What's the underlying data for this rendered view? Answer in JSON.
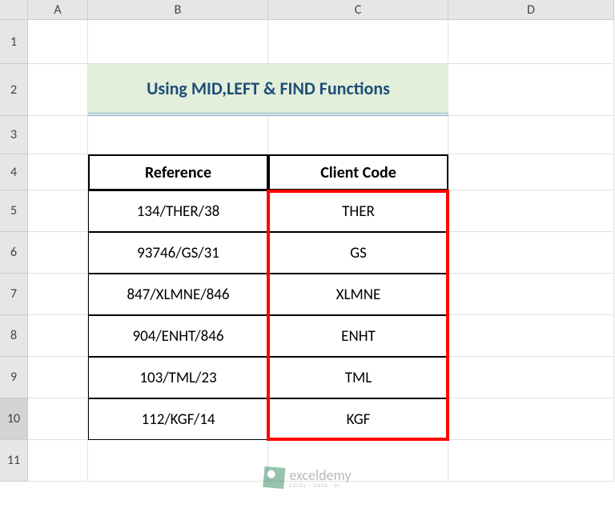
{
  "columns": [
    "A",
    "B",
    "C",
    "D"
  ],
  "rows": [
    "1",
    "2",
    "3",
    "4",
    "5",
    "6",
    "7",
    "8",
    "9",
    "10",
    "11"
  ],
  "selectedRow": "10",
  "title": "Using MID,LEFT & FIND Functions",
  "table": {
    "headers": {
      "reference": "Reference",
      "client_code": "Client Code"
    },
    "data": [
      {
        "reference": "134/THER/38",
        "code": "THER"
      },
      {
        "reference": "93746/GS/31",
        "code": "GS"
      },
      {
        "reference": "847/XLMNE/846",
        "code": "XLMNE"
      },
      {
        "reference": "904/ENHT/846",
        "code": "ENHT"
      },
      {
        "reference": "103/TML/23",
        "code": "TML"
      },
      {
        "reference": "112/KGF/14",
        "code": "KGF"
      }
    ]
  },
  "watermark": {
    "main": "exceldemy",
    "sub": "EXCEL · DATA · BI"
  },
  "chart_data": {
    "type": "table",
    "title": "Using MID,LEFT & FIND Functions",
    "columns": [
      "Reference",
      "Client Code"
    ],
    "rows": [
      [
        "134/THER/38",
        "THER"
      ],
      [
        "93746/GS/31",
        "GS"
      ],
      [
        "847/XLMNE/846",
        "XLMNE"
      ],
      [
        "904/ENHT/846",
        "ENHT"
      ],
      [
        "103/TML/23",
        "TML"
      ],
      [
        "112/KGF/14",
        "KGF"
      ]
    ]
  }
}
